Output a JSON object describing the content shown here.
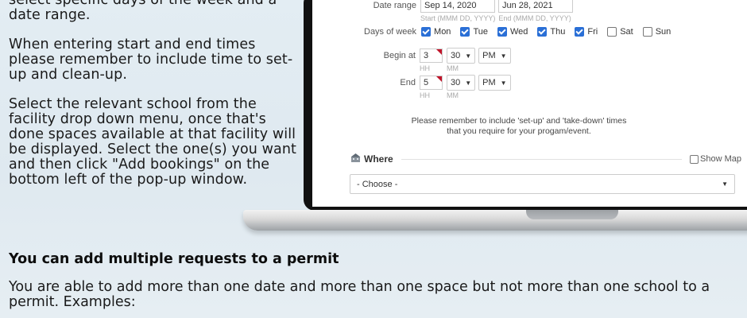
{
  "left_text": {
    "para1": "select specific days of the week and a date range.",
    "para2": "When entering start and end times please remember to include time to set-up and clean-up.",
    "para3": "Select the relevant school from the facility drop down menu, once that's done spaces available at that facility will be displayed. Select the one(s) you want and then click \"Add bookings\" on the bottom left of the pop-up window."
  },
  "form": {
    "date_range": {
      "label": "Date range",
      "start_value": "Sep 14, 2020",
      "end_value": "Jun 28, 2021",
      "start_hint": "Start (MMM DD, YYYY)",
      "end_hint": "End (MMM DD, YYYY)"
    },
    "days": {
      "label": "Days of week",
      "items": [
        {
          "label": "Mon",
          "checked": true
        },
        {
          "label": "Tue",
          "checked": true
        },
        {
          "label": "Wed",
          "checked": true
        },
        {
          "label": "Thu",
          "checked": true
        },
        {
          "label": "Fri",
          "checked": true
        },
        {
          "label": "Sat",
          "checked": false
        },
        {
          "label": "Sun",
          "checked": false
        }
      ]
    },
    "begin": {
      "label": "Begin at",
      "hour": "3",
      "minute": "30",
      "ampm": "PM",
      "hh_hint": "HH",
      "mm_hint": "MM"
    },
    "end": {
      "label": "End",
      "hour": "5",
      "minute": "30",
      "ampm": "PM",
      "hh_hint": "HH",
      "mm_hint": "MM"
    },
    "reminder_line1": "Please remember to include 'set-up' and 'take-down' times",
    "reminder_line2": "that you require for your progam/event.",
    "where": {
      "title": "Where",
      "show_map_label": "Show Map",
      "choose_value": "- Choose -"
    }
  },
  "bottom": {
    "heading": "You can add multiple requests to a permit",
    "body": "You are able to add more than one date and more than one space but not more than one school to a permit. Examples:"
  }
}
